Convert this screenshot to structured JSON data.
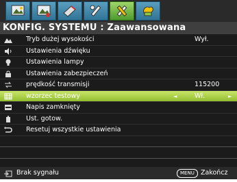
{
  "tabs": [
    {
      "icon": "picture-icon",
      "active": false
    },
    {
      "icon": "picture-advanced-icon",
      "active": false
    },
    {
      "icon": "display-icon",
      "active": false
    },
    {
      "icon": "settings-basic-icon",
      "active": false
    },
    {
      "icon": "settings-advanced-icon",
      "active": true
    },
    {
      "icon": "information-icon",
      "active": false
    }
  ],
  "header": {
    "title": "KONFIG. SYSTEMU : Zaawansowana"
  },
  "menu": {
    "items": [
      {
        "label": "Tryb dużej wysokości",
        "value": "Wył.",
        "icon": "mountain-icon"
      },
      {
        "label": "Ustawienia dźwięku",
        "value": "",
        "icon": "speaker-icon"
      },
      {
        "label": "Ustawienia lampy",
        "value": "",
        "icon": "lamp-icon"
      },
      {
        "label": "Ustawienia zabezpieczeń",
        "value": "",
        "icon": "lock-icon"
      },
      {
        "label": "prędkość transmisji",
        "value": "115200",
        "icon": "baud-rate-icon"
      },
      {
        "label": "wzorzec testowy",
        "value": "Wł.",
        "icon": "test-pattern-icon",
        "selected": true
      },
      {
        "label": "Napis zamknięty",
        "value": "",
        "icon": "closed-caption-icon"
      },
      {
        "label": "Ust. gotow.",
        "value": "",
        "icon": "standby-icon"
      },
      {
        "label": "Resetuj wszystkie ustawienia",
        "value": "",
        "icon": "reset-icon"
      }
    ]
  },
  "status": {
    "signal_text": "Brak sygnału",
    "menu_button": "MENU",
    "exit_text": "Zakończ"
  },
  "colors": {
    "selected_row": "#b5d94e",
    "background": "#1b1b1b",
    "title_bar": "#3f3f3f"
  }
}
